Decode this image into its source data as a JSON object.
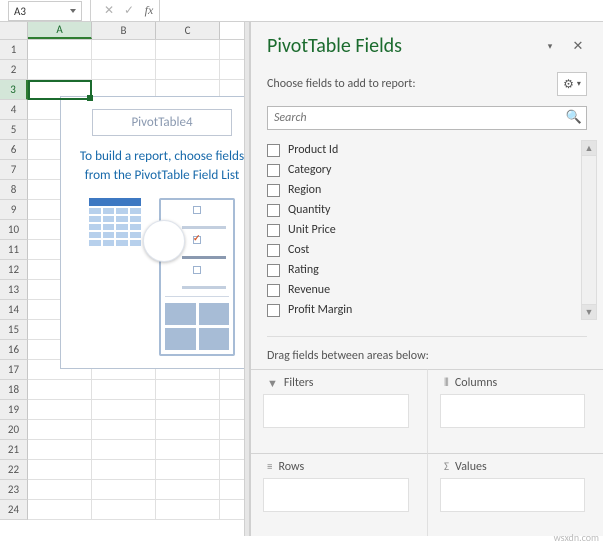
{
  "formula_bar": {
    "name_box": "A3",
    "cancel_icon": "✕",
    "confirm_icon": "✓",
    "fx_label": "fx",
    "formula_value": ""
  },
  "columns": [
    "A",
    "B",
    "C"
  ],
  "rows": [
    "1",
    "2",
    "3",
    "4",
    "5",
    "6",
    "7",
    "8",
    "9",
    "10",
    "11",
    "12",
    "13",
    "14",
    "15",
    "16",
    "17",
    "18",
    "19",
    "20",
    "21",
    "22",
    "23",
    "24"
  ],
  "selected_cell": "A3",
  "pivot_placeholder": {
    "name": "PivotTable4",
    "message": "To build a report, choose fields from the PivotTable Field List"
  },
  "pane": {
    "title": "PivotTable Fields",
    "collapse_icon": "▾",
    "close_icon": "✕",
    "subtitle": "Choose fields to add to report:",
    "gear_icon": "⚙",
    "search_placeholder": "Search",
    "search_icon": "🔍",
    "fields": [
      {
        "label": "Product Id",
        "checked": false
      },
      {
        "label": "Category",
        "checked": false
      },
      {
        "label": "Region",
        "checked": false
      },
      {
        "label": "Quantity",
        "checked": false
      },
      {
        "label": "Unit Price",
        "checked": false
      },
      {
        "label": "Cost",
        "checked": false
      },
      {
        "label": "Rating",
        "checked": false
      },
      {
        "label": "Revenue",
        "checked": false
      },
      {
        "label": "Profit Margin",
        "checked": false
      }
    ],
    "drag_label": "Drag fields between areas below:",
    "areas": {
      "filters": {
        "icon": "▼",
        "label": "Filters"
      },
      "columns": {
        "icon": "⦀",
        "label": "Columns"
      },
      "rows": {
        "icon": "≡",
        "label": "Rows"
      },
      "values": {
        "icon": "Σ",
        "label": "Values"
      }
    }
  },
  "watermark": "wsxdn.com"
}
